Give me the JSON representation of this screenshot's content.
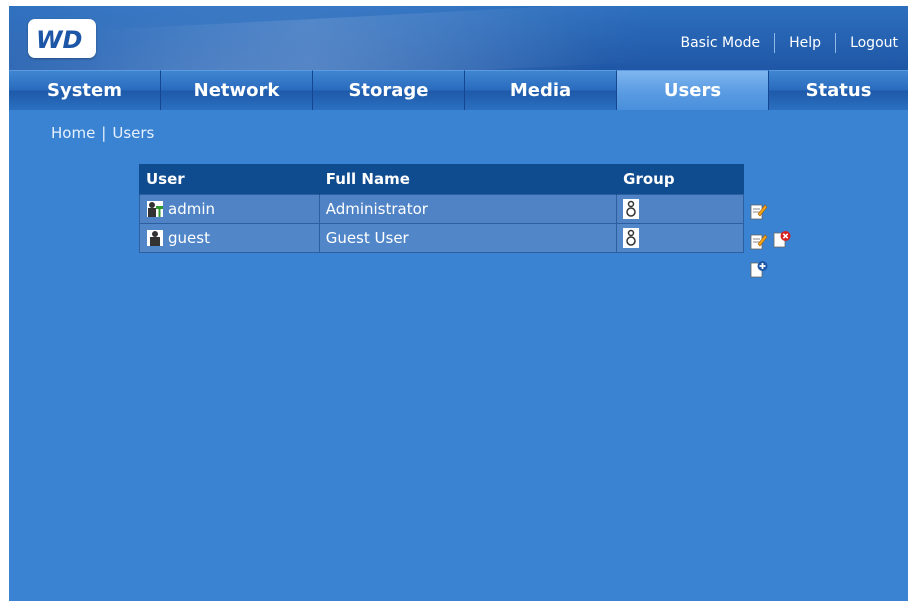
{
  "header": {
    "logo_text": "WD",
    "links": [
      {
        "label": "Basic Mode"
      },
      {
        "label": "Help"
      },
      {
        "label": "Logout"
      }
    ]
  },
  "tabs": [
    {
      "label": "System",
      "active": false
    },
    {
      "label": "Network",
      "active": false
    },
    {
      "label": "Storage",
      "active": false
    },
    {
      "label": "Media",
      "active": false
    },
    {
      "label": "Users",
      "active": true
    },
    {
      "label": "Status",
      "active": false
    }
  ],
  "breadcrumb": {
    "home": "Home",
    "separator": "|",
    "current": "Users"
  },
  "table": {
    "columns": [
      "User",
      "Full Name",
      "Group"
    ],
    "rows": [
      {
        "user": "admin",
        "full_name": "Administrator",
        "user_icon": "admin-user-icon",
        "group_icon": "group-icon",
        "actions": [
          "edit-icon"
        ]
      },
      {
        "user": "guest",
        "full_name": "Guest User",
        "user_icon": "user-icon",
        "group_icon": "group-icon",
        "actions": [
          "edit-icon",
          "delete-icon"
        ]
      }
    ],
    "add_action": "add-user-icon"
  },
  "colors": {
    "background": "#3a83d3",
    "header": "#1f57a6",
    "table_header": "#0f4b8f",
    "table_row": "#4f83c6",
    "active_tab": "#5c9de3"
  }
}
